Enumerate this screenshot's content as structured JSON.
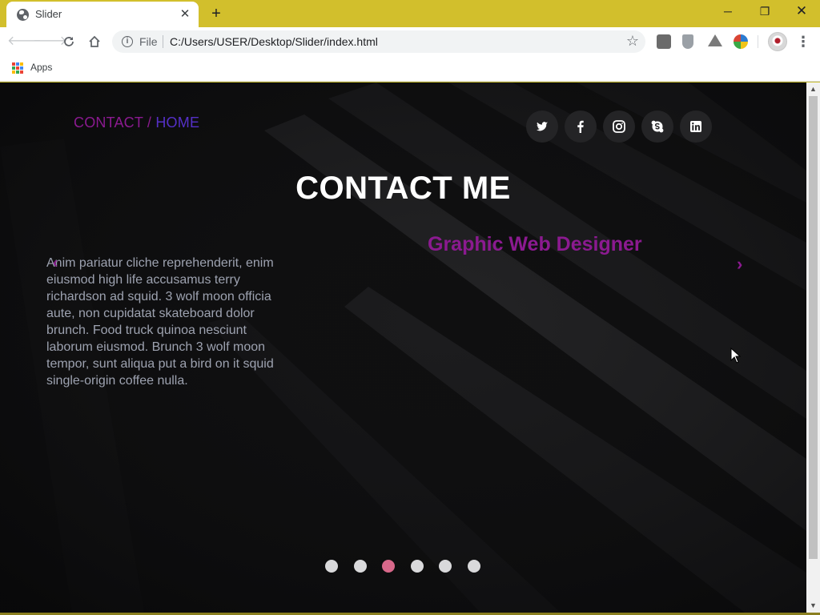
{
  "browser": {
    "tab": {
      "title": "Slider",
      "favicon": "globe-icon"
    },
    "omnibox": {
      "scheme": "File",
      "url": "C:/Users/USER/Desktop/Slider/index.html"
    },
    "bookmarks": {
      "apps_label": "Apps"
    }
  },
  "page": {
    "breadcrumb": {
      "contact": "CONTACT",
      "separator": " / ",
      "home": "HOME"
    },
    "social": [
      "twitter-icon",
      "facebook-icon",
      "instagram-icon",
      "skype-icon",
      "linkedin-icon"
    ],
    "title": "CONTACT ME",
    "subtitle": "Graphic Web Designer",
    "prev_arrow": "‹",
    "next_arrow": "›",
    "paragraph": "Anim pariatur cliche reprehenderit, enim eiusmod high life accusamus terry richardson ad squid. 3 wolf moon officia aute, non cupidatat skateboard dolor brunch. Food truck quinoa nesciunt laborum eiusmod. Brunch 3 wolf moon tempor, sunt aliqua put a bird on it squid single-origin coffee nulla.",
    "pagination": {
      "count": 6,
      "active_index": 2
    }
  },
  "colors": {
    "chrome_frame": "#d2bf2c",
    "accent_purple": "#8b1a90",
    "home_blue": "#5530c7",
    "active_dot": "#d8688a",
    "page_bg": "#0d0d0e"
  }
}
